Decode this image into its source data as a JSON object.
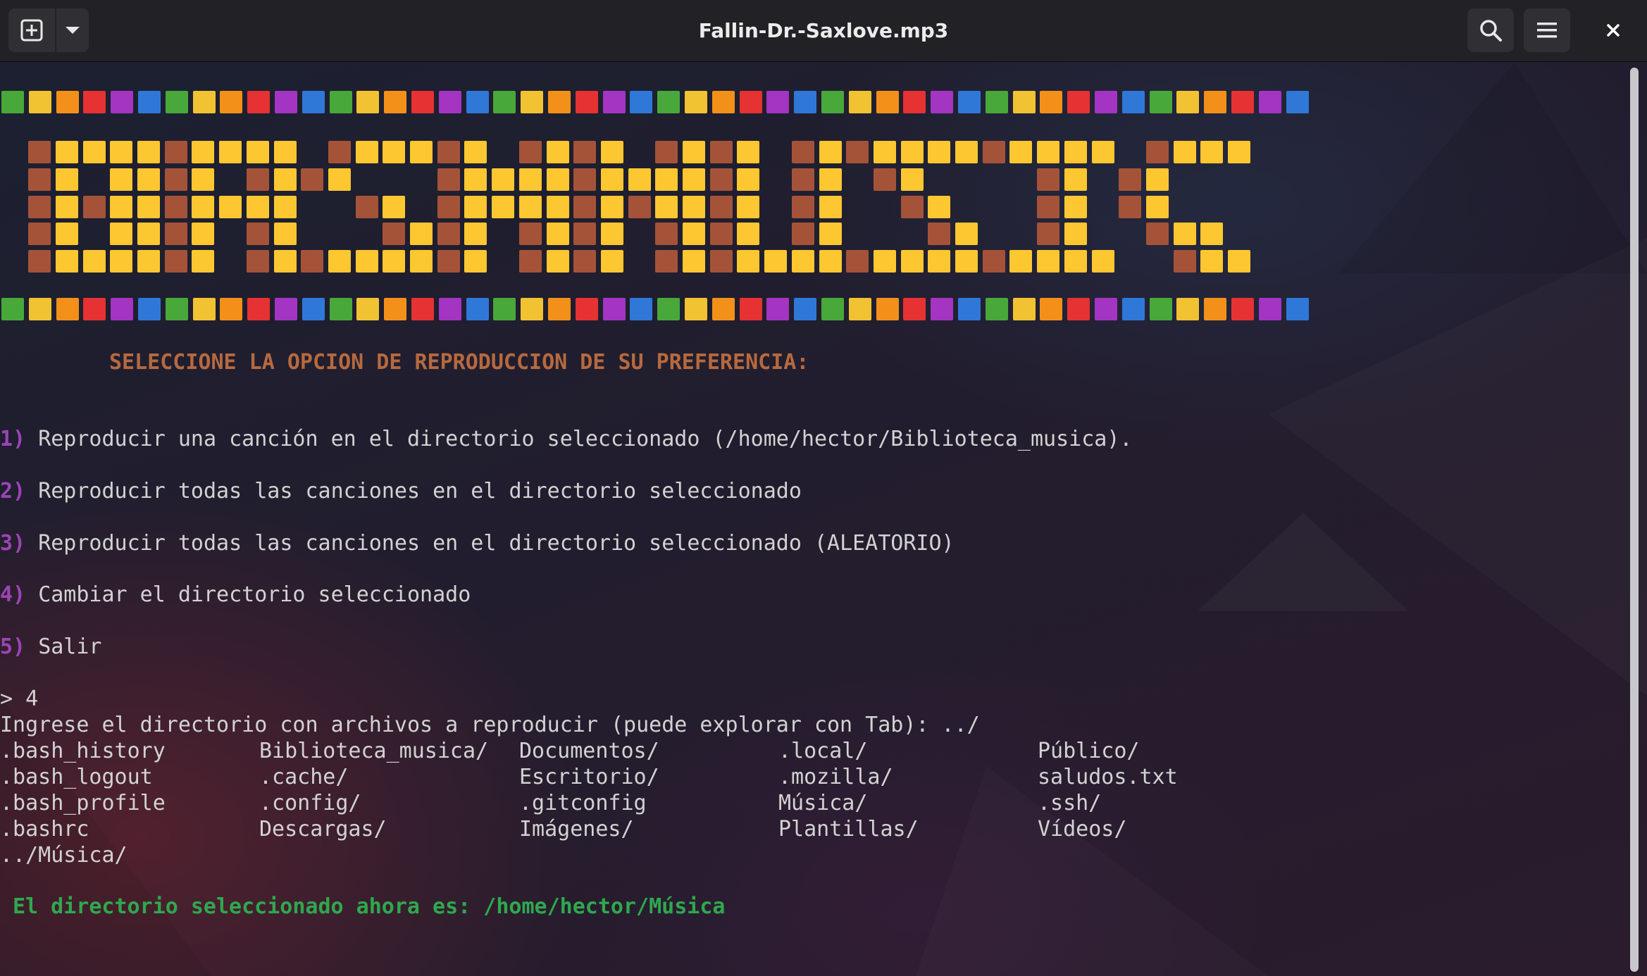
{
  "window": {
    "title": "Fallin-Dr.-Saxlove.mp3",
    "buttons": {
      "new_tab_icon": "new-tab-icon",
      "dropdown_icon": "chevron-down-icon",
      "search_icon": "search-icon",
      "menu_icon": "hamburger-menu-icon",
      "close_icon": "close-icon"
    }
  },
  "banner": {
    "logo_text": "BASHMUSIC",
    "stripe_colors": [
      "#48a83a",
      "#f1c232",
      "#f39019",
      "#e63232",
      "#a335c2",
      "#2f78d8"
    ],
    "logo_colors": {
      "dark": "#a45339",
      "light": "#fcc730"
    }
  },
  "terminal": {
    "header": "SELECCIONE LA OPCION DE REPRODUCCION DE SU PREFERENCIA:",
    "options": [
      {
        "num": "1)",
        "text": "Reproducir una canción en el directorio seleccionado (/home/hector/Biblioteca_musica)."
      },
      {
        "num": "2)",
        "text": "Reproducir todas las canciones en el directorio seleccionado"
      },
      {
        "num": "3)",
        "text": "Reproducir todas las canciones en el directorio seleccionado (ALEATORIO)"
      },
      {
        "num": "4)",
        "text": "Cambiar el directorio seleccionado"
      },
      {
        "num": "5)",
        "text": "Salir"
      }
    ],
    "prompt_line": "> 4",
    "input_line": "Ingrese el directorio con archivos a reproducir (puede explorar con Tab): ../",
    "listing": [
      [
        ".bash_history",
        ".bash_logout",
        ".bash_profile",
        ".bashrc"
      ],
      [
        "Biblioteca_musica/",
        ".cache/",
        ".config/",
        "Descargas/"
      ],
      [
        "Documentos/",
        "Escritorio/",
        ".gitconfig",
        "Imágenes/"
      ],
      [
        ".local/",
        ".mozilla/",
        "Música/",
        "Plantillas/"
      ],
      [
        "Público/",
        "saludos.txt",
        ".ssh/",
        "Vídeos/"
      ]
    ],
    "completion_line": "../Música/",
    "result": "El directorio seleccionado ahora es: /home/hector/Música",
    "colors": {
      "header": "#b7693e",
      "option_number": "#9b44b6",
      "result": "#2ea84e",
      "text": "#d2d2d2"
    }
  }
}
